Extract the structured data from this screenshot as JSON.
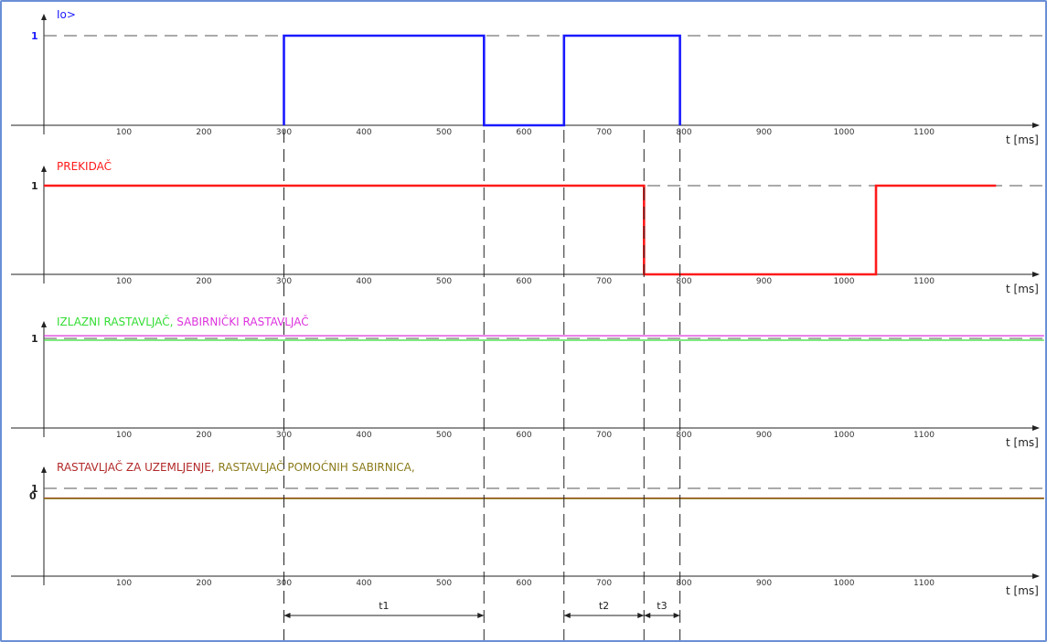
{
  "colors": {
    "io": "#1a1aff",
    "prekidac": "#ff1a1a",
    "izlazni": "#33dd33",
    "sabirnicki": "#dd33dd",
    "uzemljenje": "#b22a2a",
    "pomocnih": "#8a7a1a",
    "axis": "#222222",
    "dash": "#555555"
  },
  "x_axis_unit": "t [ms]",
  "x_ticks": [
    "100",
    "200",
    "300",
    "400",
    "500",
    "600",
    "700",
    "800",
    "900",
    "1000",
    "1100"
  ],
  "chart_data": [
    {
      "type": "line",
      "title": "Io>",
      "title_color": "#1a1aff",
      "xlabel": "t [ms]",
      "y_tick_label": "1",
      "xlim": [
        0,
        1250
      ],
      "ylim": [
        0,
        1
      ],
      "series": [
        {
          "name": "Io>",
          "color": "#1a1aff",
          "x": [
            300,
            300,
            550,
            550,
            650,
            650,
            795,
            795
          ],
          "y": [
            0,
            1,
            1,
            0,
            0,
            1,
            1,
            0
          ]
        }
      ]
    },
    {
      "type": "line",
      "title": "PREKIDAČ",
      "title_color": "#ff1a1a",
      "xlabel": "t [ms]",
      "y_tick_label": "1",
      "xlim": [
        0,
        1250
      ],
      "ylim": [
        0,
        1
      ],
      "series": [
        {
          "name": "PREKIDAČ",
          "color": "#ff1a1a",
          "x": [
            0,
            750,
            750,
            1040,
            1040,
            1190
          ],
          "y": [
            1,
            1,
            0,
            0,
            1,
            1
          ]
        }
      ]
    },
    {
      "type": "line",
      "title_parts": [
        {
          "text": "IZLAZNI RASTAVLJAČ, ",
          "color": "#33dd33"
        },
        {
          "text": "SABIRNIČKI RASTAVLJAČ",
          "color": "#dd33dd"
        }
      ],
      "xlabel": "t [ms]",
      "y_tick_label": "1",
      "xlim": [
        0,
        1250
      ],
      "ylim": [
        0,
        1
      ],
      "series": [
        {
          "name": "IZLAZNI RASTAVLJAČ",
          "color": "#33dd33",
          "x": [
            0,
            1250
          ],
          "y": [
            0.98,
            0.98
          ]
        },
        {
          "name": "SABIRNIČKI RASTAVLJAČ",
          "color": "#dd33dd",
          "x": [
            0,
            1250
          ],
          "y": [
            1.03,
            1.03
          ]
        }
      ]
    },
    {
      "type": "line",
      "title_parts": [
        {
          "text": "RASTAVLJAČ ZA UZEMLJENJE, ",
          "color": "#b22a2a"
        },
        {
          "text": "RASTAVLJAČ POMOĆNIH SABIRNICA,",
          "color": "#8a7a1a"
        }
      ],
      "xlabel": "t [ms]",
      "y_tick_labels": [
        "1",
        "0"
      ],
      "xlim": [
        0,
        1250
      ],
      "ylim": [
        0,
        1
      ],
      "series": [
        {
          "name": "RASTAVLJAČ ZA UZEMLJENJE",
          "color": "#b22a2a",
          "x": [
            0,
            1250
          ],
          "y": [
            0.03,
            0.03
          ]
        },
        {
          "name": "RASTAVLJAČ POMOĆNIH SABIRNICA",
          "color": "#8a7a1a",
          "x": [
            0,
            1250
          ],
          "y": [
            -0.02,
            -0.02
          ]
        }
      ]
    }
  ],
  "markers_ms": [
    300,
    550,
    650,
    750,
    795
  ],
  "intervals": [
    {
      "label": "t1",
      "from": 300,
      "to": 550
    },
    {
      "label": "t2",
      "from": 650,
      "to": 750
    },
    {
      "label": "t3",
      "from": 750,
      "to": 795
    }
  ]
}
